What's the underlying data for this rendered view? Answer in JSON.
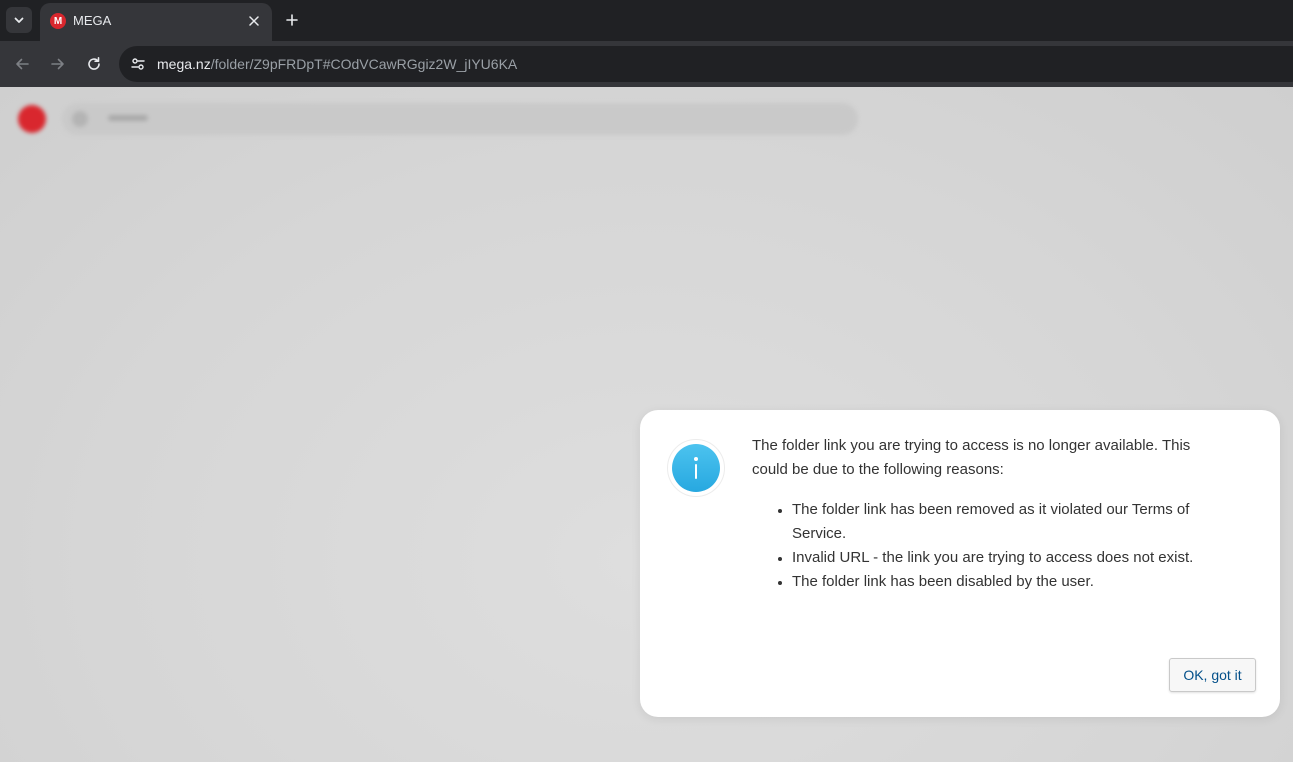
{
  "browser": {
    "tab": {
      "title": "MEGA",
      "favicon_letter": "M"
    },
    "address_bar": {
      "host": "mega.nz",
      "path": "/folder/Z9pFRDpT#COdVCawRGgiz2W_jIYU6KA"
    }
  },
  "dialog": {
    "message": "The folder link you are trying to access is no longer available. This could be due to the following reasons:",
    "reasons": [
      "The folder link has been removed as it violated our Terms of Service.",
      "Invalid URL - the link you are trying to access does not exist.",
      "The folder link has been disabled by the user."
    ],
    "ok_label": "OK, got it",
    "icon": "info-icon"
  },
  "colors": {
    "brand_red": "#d9272e",
    "info_blue": "#2fb2e6",
    "button_text": "#04508a"
  }
}
